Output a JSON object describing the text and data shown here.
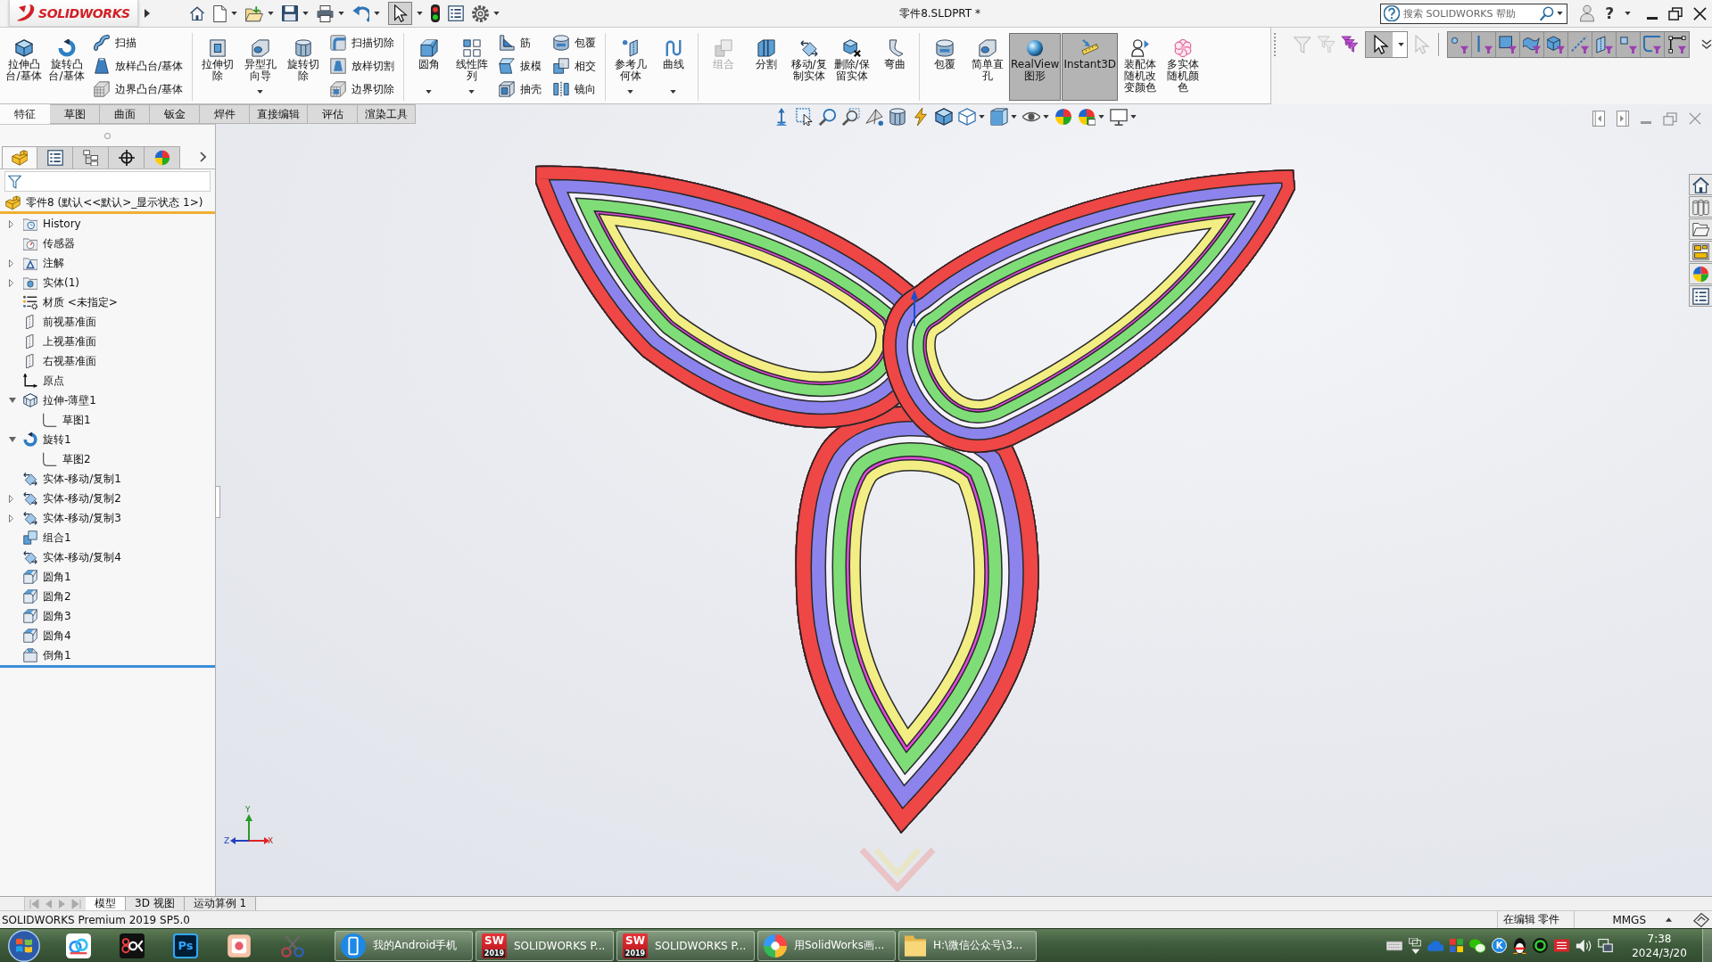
{
  "title_bar": {
    "logo": "SOLIDWORKS",
    "title": "零件8.SLDPRT *",
    "search": {
      "placeholder": "搜索 SOLIDWORKS 帮助"
    },
    "help": "?",
    "select_tool": {
      "selected": true
    }
  },
  "ribbon": {
    "groups": [
      {
        "large": [
          {
            "label": "拉伸凸台/基体",
            "dropdown": false,
            "disabled": false,
            "selected": false
          },
          {
            "label": "旋转凸台/基体",
            "dropdown": false,
            "disabled": false,
            "selected": false
          }
        ],
        "small_columns": [
          [
            {
              "label": "扫描"
            },
            {
              "label": "放样凸台/基体"
            },
            {
              "label": "边界凸台/基体"
            }
          ]
        ]
      },
      {
        "large": [
          {
            "label": "拉伸切除",
            "dropdown": false,
            "disabled": false,
            "selected": false
          },
          {
            "label": "异型孔向导",
            "dropdown": true,
            "disabled": false,
            "selected": false
          },
          {
            "label": "旋转切除",
            "dropdown": false,
            "disabled": false,
            "selected": false
          }
        ],
        "small_columns": [
          [
            {
              "label": "扫描切除"
            },
            {
              "label": "放样切割"
            },
            {
              "label": "边界切除"
            }
          ]
        ]
      },
      {
        "large": [
          {
            "label": "圆角",
            "dropdown": true,
            "disabled": false,
            "selected": false
          },
          {
            "label": "线性阵列",
            "dropdown": true,
            "disabled": false,
            "selected": false
          }
        ],
        "small_columns": [
          [
            {
              "label": "筋"
            },
            {
              "label": "拔模"
            },
            {
              "label": "抽壳"
            }
          ],
          [
            {
              "label": "包覆"
            },
            {
              "label": "相交"
            },
            {
              "label": "镜向"
            }
          ]
        ]
      },
      {
        "large": [
          {
            "label": "参考几何体",
            "dropdown": true,
            "disabled": false,
            "selected": false
          },
          {
            "label": "曲线",
            "dropdown": true,
            "disabled": false,
            "selected": false
          }
        ]
      },
      {
        "large": [
          {
            "label": "组合",
            "dropdown": false,
            "disabled": true,
            "selected": false
          },
          {
            "label": "分割",
            "dropdown": false,
            "disabled": false,
            "selected": false
          },
          {
            "label": "移动/复制实体",
            "dropdown": false,
            "disabled": false,
            "selected": false
          },
          {
            "label": "删除/保留实体",
            "dropdown": false,
            "disabled": false,
            "selected": false
          },
          {
            "label": "弯曲",
            "dropdown": false,
            "disabled": false,
            "selected": false
          }
        ]
      },
      {
        "large": [
          {
            "label": "包覆",
            "dropdown": false,
            "disabled": false,
            "selected": false
          },
          {
            "label": "简单直孔",
            "dropdown": false,
            "disabled": false,
            "selected": false
          },
          {
            "label": "RealView图形",
            "dropdown": false,
            "disabled": false,
            "selected": true
          },
          {
            "label": "Instant3D",
            "dropdown": false,
            "disabled": false,
            "selected": true
          },
          {
            "label": "装配体随机改变颜色",
            "dropdown": false,
            "disabled": false,
            "selected": false
          },
          {
            "label": "多实体随机颜色",
            "dropdown": false,
            "disabled": false,
            "selected": false
          }
        ]
      }
    ],
    "tabs": [
      {
        "label": "特征",
        "selected": true
      },
      {
        "label": "草图",
        "selected": false
      },
      {
        "label": "曲面",
        "selected": false
      },
      {
        "label": "钣金",
        "selected": false
      },
      {
        "label": "焊件",
        "selected": false
      },
      {
        "label": "直接编辑",
        "selected": false
      },
      {
        "label": "评估",
        "selected": false
      },
      {
        "label": "渲染工具",
        "selected": false
      }
    ]
  },
  "filter_toolbar": {
    "funnels": [
      {
        "disabled": true
      },
      {
        "disabled": true
      },
      {
        "disabled": false
      }
    ],
    "select_tool": {
      "selected": true
    },
    "select_other": {
      "disabled": true
    },
    "filters": [
      {
        "selected": true
      },
      {
        "selected": true
      },
      {
        "selected": true
      },
      {
        "selected": true
      },
      {
        "selected": true
      },
      {
        "selected": true
      },
      {
        "selected": true
      },
      {
        "selected": true
      },
      {
        "selected": true
      },
      {
        "selected": true
      }
    ]
  },
  "feature_manager": {
    "tabs": [
      {
        "selected": true
      },
      {
        "selected": false
      },
      {
        "selected": false
      },
      {
        "selected": false
      },
      {
        "selected": false
      }
    ],
    "root": {
      "label": "零件8 (默认<<默认>_显示状态 1>)"
    },
    "tree": [
      {
        "label": "History",
        "kind": "history",
        "expanded": false
      },
      {
        "label": "传感器",
        "kind": "sensors"
      },
      {
        "label": "注解",
        "kind": "annotations",
        "expanded": false
      },
      {
        "label": "实体(1)",
        "kind": "bodies",
        "expanded": false
      },
      {
        "label": "材质 <未指定>",
        "kind": "material"
      },
      {
        "label": "前视基准面",
        "kind": "plane"
      },
      {
        "label": "上视基准面",
        "kind": "plane"
      },
      {
        "label": "右视基准面",
        "kind": "plane"
      },
      {
        "label": "原点",
        "kind": "origin"
      },
      {
        "label": "拉伸-薄壁1",
        "kind": "thin-extrude",
        "expanded": true,
        "children": [
          {
            "label": "草图1",
            "kind": "sketch"
          }
        ]
      },
      {
        "label": "旋转1",
        "kind": "revolve",
        "expanded": true,
        "children": [
          {
            "label": "草图2",
            "kind": "sketch"
          }
        ]
      },
      {
        "label": "实体-移动/复制1",
        "kind": "move-copy"
      },
      {
        "label": "实体-移动/复制2",
        "kind": "move-copy",
        "expanded": false
      },
      {
        "label": "实体-移动/复制3",
        "kind": "move-copy",
        "expanded": false
      },
      {
        "label": "组合1",
        "kind": "combine"
      },
      {
        "label": "实体-移动/复制4",
        "kind": "move-copy"
      },
      {
        "label": "圆角1",
        "kind": "fillet"
      },
      {
        "label": "圆角2",
        "kind": "fillet"
      },
      {
        "label": "圆角3",
        "kind": "fillet"
      },
      {
        "label": "圆角4",
        "kind": "fillet"
      },
      {
        "label": "倒角1",
        "kind": "chamfer"
      }
    ]
  },
  "viewport": {
    "triad": {
      "y": "Y",
      "z": "Z",
      "x": "X"
    }
  },
  "model_tabs": [
    {
      "label": "模型",
      "selected": true
    },
    {
      "label": "3D 视图",
      "selected": false
    },
    {
      "label": "运动算例 1",
      "selected": false
    }
  ],
  "status_bar": {
    "product": "SOLIDWORKS Premium 2019 SP5.0",
    "mode": "在编辑 零件",
    "units": "MMGS"
  },
  "taskbar": {
    "pinned_tile": "Ps",
    "tasks": [
      {
        "label": "我的Android手机",
        "kind": "phone"
      },
      {
        "label": "SOLIDWORKS P...",
        "kind": "app",
        "icon_text": "SW",
        "icon_year": "2019"
      },
      {
        "label": "SOLIDWORKS P...",
        "kind": "app",
        "icon_text": "SW",
        "icon_year": "2019"
      },
      {
        "label": "用SolidWorks画...",
        "kind": "browser"
      },
      {
        "label": "H:\\微信公众号\\3...",
        "kind": "folder"
      }
    ],
    "tray_badge": "K",
    "clock": {
      "time": "7:38",
      "date": "2024/3/20"
    }
  }
}
